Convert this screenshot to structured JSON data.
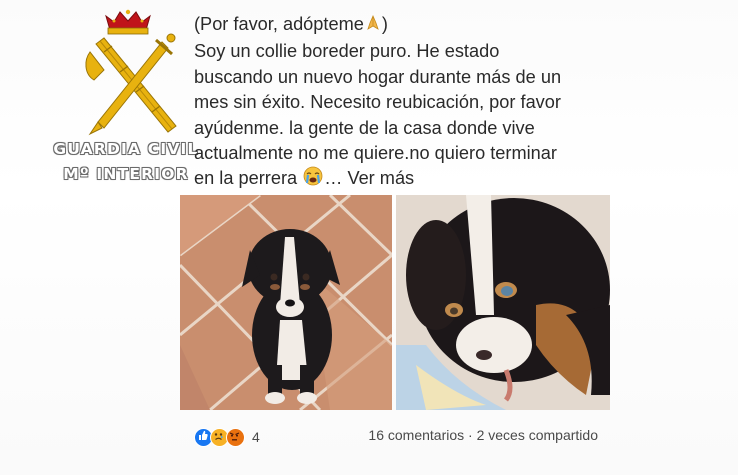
{
  "emblem": {
    "line1": "GUARDIA CIVIL",
    "line2": "Mº INTERIOR"
  },
  "post": {
    "lines": [
      "(Por favor, adópteme",
      "Soy un collie boreder puro. He estado",
      "buscando un nuevo hogar durante más de un",
      "mes sin éxito. Necesito reubicación, por favor",
      "ayúdenme.  la gente de la casa donde vive",
      "actualmente no me quiere.no quiero terminar",
      "en la perrera"
    ],
    "line1_end": ")",
    "ellipsis": "…",
    "see_more": "Ver más"
  },
  "footer": {
    "reaction_count": "4",
    "comments": "16 comentarios",
    "separator": "·",
    "shares": "2 veces compartido"
  },
  "icons": {
    "pray": "pray-emoji-icon",
    "crying": "crying-emoji-icon",
    "like": "like-reaction-icon",
    "sad": "sad-reaction-icon",
    "angry": "angry-reaction-icon"
  },
  "colors": {
    "like": "#1877f2",
    "sad": "#f7b125",
    "angry": "#e9710f",
    "emblem_gold": "#e8b20f",
    "crown_red": "#c0141a"
  }
}
